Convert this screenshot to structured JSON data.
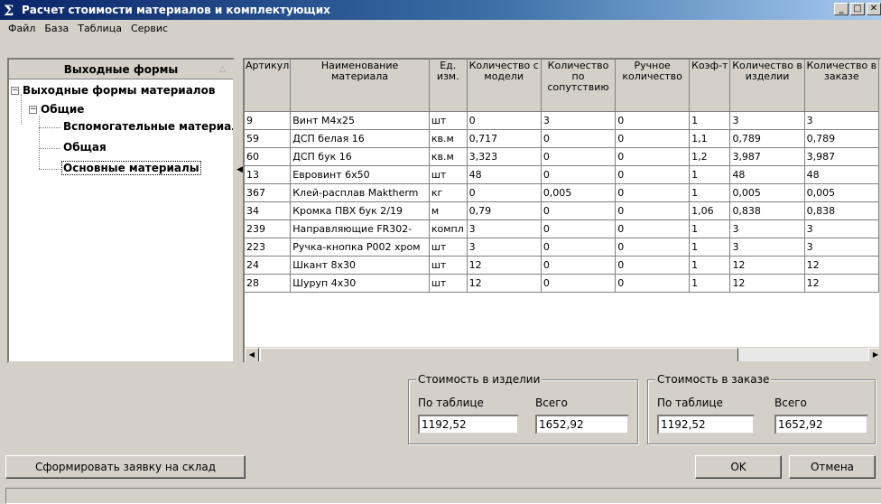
{
  "window": {
    "title": "Расчет стоимости материалов и комплектующих",
    "title_icon": "Σ"
  },
  "menu": [
    "Файл",
    "База",
    "Таблица",
    "Сервис"
  ],
  "tree": {
    "header": "Выходные формы",
    "root": "Выходные формы материалов",
    "group": "Общие",
    "items": [
      "Вспомогательные материалы",
      "Общая",
      "Основные материалы"
    ]
  },
  "table": {
    "columns": [
      "Артикул",
      "Наименование материала",
      "Ед. изм.",
      "Количество с модели",
      "Количество по сопутствию",
      "Ручное количество",
      "Коэф-т",
      "Количество в изделии",
      "Количество в заказе"
    ],
    "rows": [
      [
        "9",
        "Винт М4х25",
        "шт",
        "0",
        "3",
        "0",
        "1",
        "3",
        "3"
      ],
      [
        "59",
        "ДСП белая 16",
        "кв.м",
        "0,717",
        "0",
        "0",
        "1,1",
        "0,789",
        "0,789"
      ],
      [
        "60",
        "ДСП бук 16",
        "кв.м",
        "3,323",
        "0",
        "0",
        "1,2",
        "3,987",
        "3,987"
      ],
      [
        "13",
        "Евровинт 6х50",
        "шт",
        "48",
        "0",
        "0",
        "1",
        "48",
        "48"
      ],
      [
        "367",
        "Клей-расплав Maktherm",
        "кг",
        "0",
        "0,005",
        "0",
        "1",
        "0,005",
        "0,005"
      ],
      [
        "34",
        "Кромка ПВХ бук 2/19",
        "м",
        "0,79",
        "0",
        "0",
        "1,06",
        "0,838",
        "0,838"
      ],
      [
        "239",
        "Направляющие FR302-",
        "компл",
        "3",
        "0",
        "0",
        "1",
        "3",
        "3"
      ],
      [
        "223",
        "Ручка-кнопка P002 хром",
        "шт",
        "3",
        "0",
        "0",
        "1",
        "3",
        "3"
      ],
      [
        "24",
        "Шкант 8х30",
        "шт",
        "12",
        "0",
        "0",
        "1",
        "12",
        "12"
      ],
      [
        "28",
        "Шуруп 4х30",
        "шт",
        "12",
        "0",
        "0",
        "1",
        "12",
        "12"
      ]
    ]
  },
  "cost_item": {
    "title": "Стоимость в изделии",
    "table_label": "По таблице",
    "total_label": "Всего",
    "table_value": "1192,52",
    "total_value": "1652,92"
  },
  "cost_order": {
    "title": "Стоимость в заказе",
    "table_label": "По таблице",
    "total_label": "Всего",
    "table_value": "1192,52",
    "total_value": "1652,92"
  },
  "buttons": {
    "create_request": "Сформировать заявку на склад",
    "ok": "OK",
    "cancel": "Отмена"
  }
}
